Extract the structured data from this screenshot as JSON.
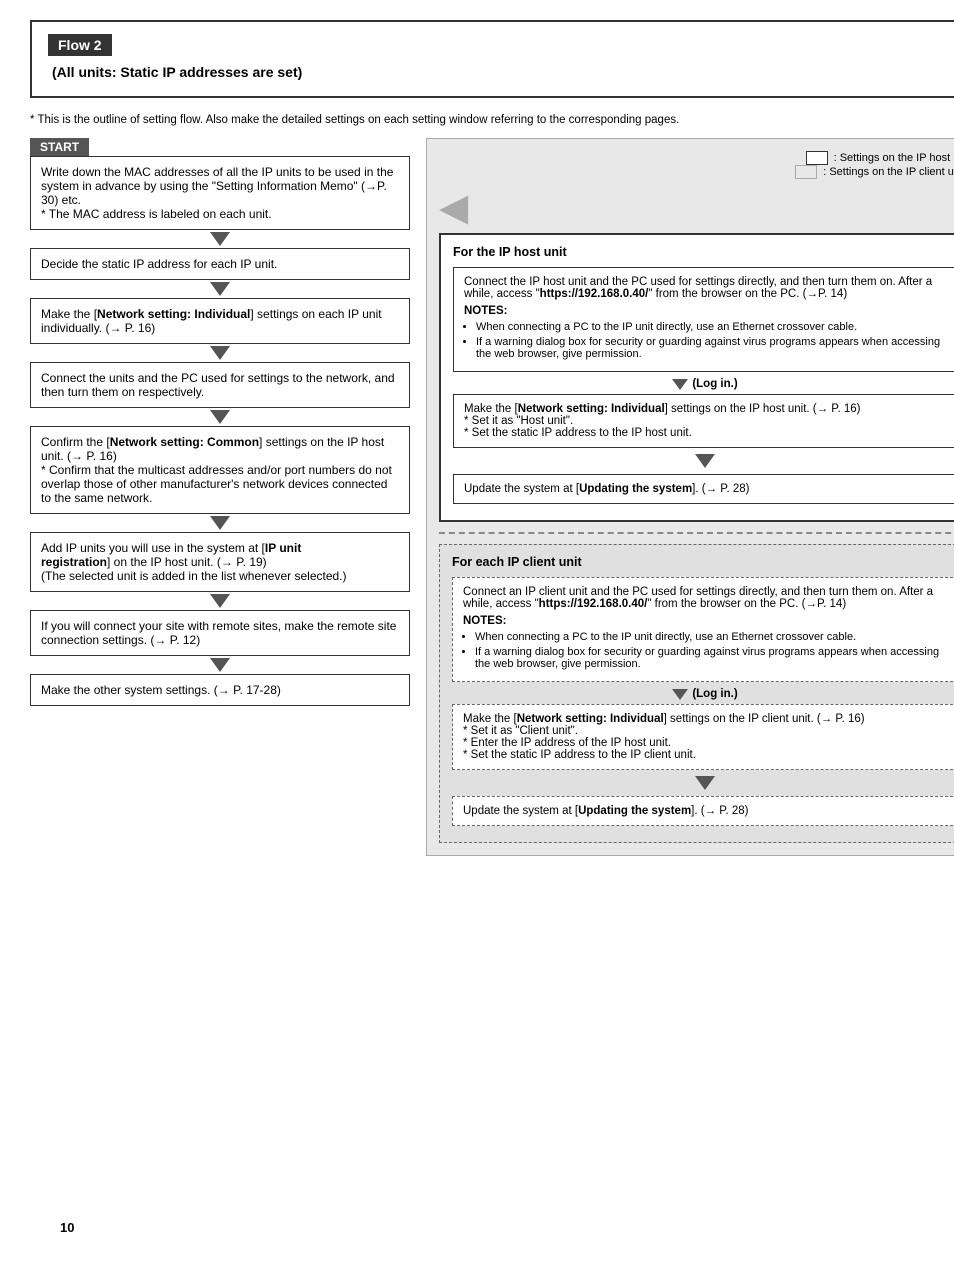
{
  "page": {
    "number": "10",
    "outline_note": "* This is the outline of setting flow. Also make the detailed settings on each setting window referring to the corresponding pages.",
    "flow_title": "Flow 2",
    "flow_subtitle": "(All units: Static IP addresses are set)",
    "legend": {
      "host_label": ": Settings on the IP host unit",
      "client_label": ": Settings on the IP client units"
    },
    "start_label": "START",
    "left_flow": {
      "box1_text": "Write down the MAC addresses of all the IP units to be used in the system in advance by using the \"Setting Information Memo\" (→P. 30) etc.\n* The MAC address is labeled on each unit.",
      "box2_text": "Decide the static IP address for each IP unit.",
      "box3_text": "Make the [Network setting: Individual] settings on each IP unit individually. (→ P. 16)",
      "box3_bold": "Network setting: Individual",
      "box4_text": "Connect the units and the PC used for settings to the network, and then turn them on respectively.",
      "box5_text": "Confirm the [Network setting: Common] settings on the IP host unit. (→ P. 16)\n* Confirm that the multicast addresses and/or port numbers do not overlap those of other manufacturer's network devices connected to the same network.",
      "box5_bold": "Network setting: Common",
      "box6_text": "Add IP units you will use in the system at [IP unit registration] on the IP host unit. (→ P. 19)\n(The selected unit is added in the list whenever selected.)",
      "box6_bold1": "IP unit",
      "box6_bold2": "registration",
      "box7_text": "If you will connect your site with remote sites, make the remote site connection settings. (→ P. 12)",
      "box8_text": "Make the other system settings. (→ P. 17-28)"
    },
    "right_section": {
      "host_title": "For the IP host unit",
      "host_box1": {
        "text": "Connect the IP host unit and the PC used for settings directly, and then turn them on. After a while, access \"https://192.168.0.40/\" from the browser on the PC. (→P. 14)",
        "bold_url": "https://192.168.0.40/",
        "notes_label": "NOTES:",
        "note1": "When connecting a PC to the IP unit directly, use an Ethernet crossover cable.",
        "note2": "If a warning dialog box for security or guarding against virus programs appears when accessing the web browser, give permission."
      },
      "host_login": "(Log in.)",
      "host_box2": {
        "text": "Make the [Network setting: Individual] settings on the IP host unit. (→ P. 16)\n*  Set it as \"Host unit\".\n*  Set the static IP address to the IP host unit.",
        "bold": "Network setting: Individual"
      },
      "host_box3": {
        "text": "Update the system at [Updating the system]. (→ P. 28)",
        "bold": "Updating the system"
      },
      "client_title": "For each IP client unit",
      "client_box1": {
        "text": "Connect an IP client unit and the PC used for settings directly, and then turn them on. After a while, access \"https://192.168.0.40/\" from the browser on the PC. (→P. 14)",
        "bold_url": "https://192.168.0.40/",
        "notes_label": "NOTES:",
        "note1": "When connecting a PC to the IP unit directly, use an Ethernet crossover cable.",
        "note2": "If a warning dialog box for security or guarding against virus programs appears when accessing the web browser, give permission."
      },
      "client_login": "(Log in.)",
      "client_box2": {
        "text": "Make the [Network setting: Individual] settings on the IP client unit. (→ P. 16)\n*  Set it as \"Client unit\".\n*  Enter the IP address of the IP host unit.\n*  Set the static IP address to the IP client unit.",
        "bold": "Network setting: Individual"
      },
      "client_box3": {
        "text": "Update the system at [Updating the system]. (→ P. 28)",
        "bold": "Updating the system"
      }
    }
  }
}
